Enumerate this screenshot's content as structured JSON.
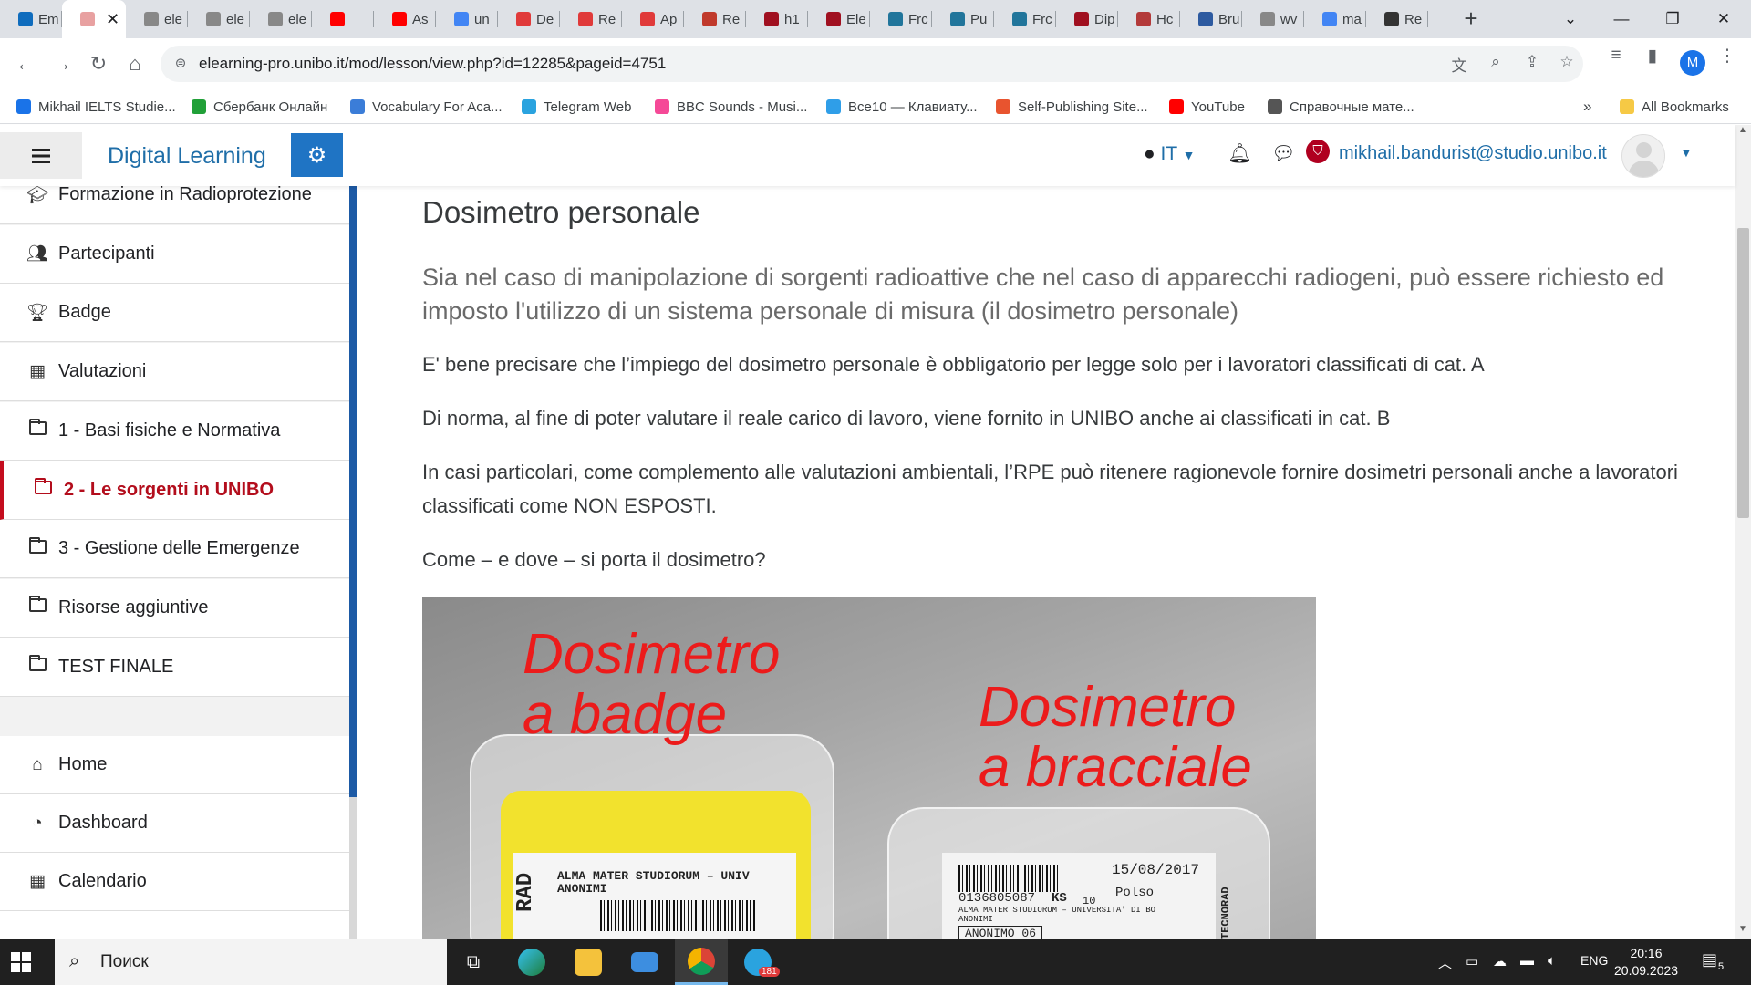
{
  "browser": {
    "tabs": [
      {
        "title": "Em",
        "fav": "#0f6cbd",
        "icon": "outlook-icon"
      },
      {
        "title": "",
        "fav": "#e8a1a1",
        "icon": "moodle-icon",
        "active": true
      },
      {
        "title": "ele",
        "fav": "#888888",
        "icon": "globe-icon"
      },
      {
        "title": "ele",
        "fav": "#888888",
        "icon": "globe-icon"
      },
      {
        "title": "ele",
        "fav": "#888888",
        "icon": "globe-icon"
      },
      {
        "title": "",
        "fav": "#ff0000",
        "icon": "youtube-icon"
      },
      {
        "title": "As",
        "fav": "#ff0000",
        "icon": "youtube-icon"
      },
      {
        "title": "un",
        "fav": "#4285f4",
        "icon": "google-icon"
      },
      {
        "title": "De",
        "fav": "#e03a3a",
        "icon": "site-icon"
      },
      {
        "title": "Re",
        "fav": "#e03a3a",
        "icon": "site-icon"
      },
      {
        "title": "Ap",
        "fav": "#e03a3a",
        "icon": "site-icon"
      },
      {
        "title": "Re",
        "fav": "#c0392b",
        "icon": "site-icon"
      },
      {
        "title": "h1",
        "fav": "#a01020",
        "icon": "shield-icon"
      },
      {
        "title": "Ele",
        "fav": "#a01020",
        "icon": "shield-icon"
      },
      {
        "title": "Frc",
        "fav": "#21759b",
        "icon": "wordpress-icon"
      },
      {
        "title": "Pu",
        "fav": "#21759b",
        "icon": "wordpress-icon"
      },
      {
        "title": "Frc",
        "fav": "#21759b",
        "icon": "wordpress-icon"
      },
      {
        "title": "Dip",
        "fav": "#a01020",
        "icon": "shield-icon"
      },
      {
        "title": "Hc",
        "fav": "#b33a3a",
        "icon": "site-icon"
      },
      {
        "title": "Bru",
        "fav": "#2d5aa0",
        "icon": "site-icon"
      },
      {
        "title": "wv",
        "fav": "#888888",
        "icon": "globe-icon"
      },
      {
        "title": "ma",
        "fav": "#4285f4",
        "icon": "google-icon"
      },
      {
        "title": "Re",
        "fav": "#333333",
        "icon": "site-icon"
      }
    ],
    "url": "elearning-pro.unibo.it/mod/lesson/view.php?id=12285&pageid=4751",
    "profile_initial": "M",
    "bookmarks": [
      {
        "label": "Mikhail IELTS Studie...",
        "fav": "#1a73e8"
      },
      {
        "label": "Сбербанк Онлайн",
        "fav": "#21a038"
      },
      {
        "label": "Vocabulary For Aca...",
        "fav": "#3b7dd8"
      },
      {
        "label": "Telegram Web",
        "fav": "#2aa3df"
      },
      {
        "label": "BBC Sounds - Musi...",
        "fav": "#f54997"
      },
      {
        "label": "Все10 — Клавиату...",
        "fav": "#2f9ee8"
      },
      {
        "label": "Self-Publishing Site...",
        "fav": "#e8542f"
      },
      {
        "label": "YouTube",
        "fav": "#ff0000"
      },
      {
        "label": "Справочные мате...",
        "fav": "#555555"
      }
    ],
    "more_bookmarks": "»",
    "all_bookmarks": "All Bookmarks"
  },
  "navbar": {
    "site_name": "Digital Learning",
    "language": "IT",
    "user_email": "mikhail.bandurist@studio.unibo.it",
    "brand_color": "#1f74c4"
  },
  "sidebar": {
    "items": [
      {
        "label": "Formazione in Radioprotezione",
        "icon": "graduation-cap-icon"
      },
      {
        "label": "Partecipanti",
        "icon": "users-icon"
      },
      {
        "label": "Badge",
        "icon": "trophy-icon"
      },
      {
        "label": "Valutazioni",
        "icon": "table-icon"
      },
      {
        "label": "1 - Basi fisiche e Normativa",
        "icon": "folder-icon"
      },
      {
        "label": "2 - Le sorgenti in UNIBO",
        "icon": "folder-icon",
        "active": true
      },
      {
        "label": "3 - Gestione delle Emergenze",
        "icon": "folder-icon"
      },
      {
        "label": "Risorse aggiuntive",
        "icon": "folder-icon"
      },
      {
        "label": "TEST FINALE",
        "icon": "folder-icon"
      }
    ],
    "nav": [
      {
        "label": "Home",
        "icon": "home-icon"
      },
      {
        "label": "Dashboard",
        "icon": "dashboard-icon"
      },
      {
        "label": "Calendario",
        "icon": "calendar-icon"
      }
    ],
    "active_color": "#b30d1c"
  },
  "content": {
    "title": "Dosimetro personale",
    "lead": "Sia nel caso di manipolazione di sorgenti radioattive che nel caso di apparecchi radiogeni, può essere richiesto ed imposto l'utilizzo di un sistema personale di misura (il dosimetro personale)",
    "paragraphs": [
      "E' bene precisare che l’impiego del dosimetro personale è obbligatorio per legge solo per i lavoratori  classificati di cat. A",
      "Di norma, al fine di poter valutare il reale carico di lavoro, viene fornito in UNIBO anche ai classificati in cat. B",
      "In casi particolari, come complemento alle valutazioni ambientali, l’RPE può ritenere ragionevole fornire dosimetri personali anche a lavoratori classificati come NON ESPOSTI.",
      "Come – e dove – si porta il dosimetro?"
    ],
    "image": {
      "label_badge_1": "Dosimetro",
      "label_badge_2": "a badge",
      "label_wrist_1": "Dosimetro",
      "label_wrist_2": "a bracciale",
      "badge_text_1": "ALMA MATER STUDIORUM – UNIV",
      "badge_text_2": "ANONIMI",
      "badge_side": "RAD",
      "wrist_date": "15/08/2017",
      "wrist_id": "0136805087",
      "wrist_code": "KS",
      "wrist_num": "10",
      "wrist_pos": "Polso",
      "wrist_org": "ALMA MATER STUDIORUM – UNIVERSITA' DI BO",
      "wrist_anon": "ANONIMI",
      "wrist_anon2": "ANONIMO 06",
      "wrist_side": "TECNORAD",
      "label_color": "#ec1b1b"
    }
  },
  "taskbar": {
    "search_placeholder": "Поиск",
    "language": "ENG",
    "time": "20:16",
    "date": "20.09.2023",
    "notifications": "5",
    "telegram_badge": "181"
  }
}
